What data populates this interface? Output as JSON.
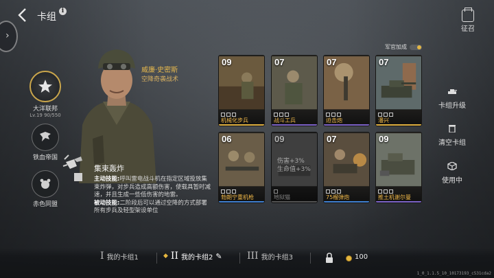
{
  "header": {
    "title": "卡组",
    "recruit_label": "征召"
  },
  "factions": [
    {
      "name": "大洋联邦",
      "level": "Lv.19  90/550",
      "icon": "star-icon",
      "active": true
    },
    {
      "name": "铁血帝国",
      "icon": "eagle-icon",
      "active": false
    },
    {
      "name": "赤色同盟",
      "icon": "bear-icon",
      "active": false
    }
  ],
  "commander": {
    "name": "威廉·史密斯",
    "subtitle": "空降奇袭战术",
    "skill_title": "集束轰炸",
    "active_label": "主动技能:",
    "active_text": "呼叫雷电战斗机在指定区域投放集束炸弹，对步兵造成高额伤害，使载具暂时减速，并且生成一些低伤害的地雷。",
    "passive_label": "被动技能:",
    "passive_text": "二阶段后可以通过空降的方式部署所有步兵及轻型架设单位"
  },
  "deck": {
    "bonus_label": "军官加成",
    "cards": [
      {
        "cost": "09",
        "name": "机械化步兵",
        "color": "#e0b040"
      },
      {
        "cost": "07",
        "name": "战斗工兵",
        "color": "#7b62c8"
      },
      {
        "cost": "07",
        "name": "迫击炮",
        "color": "#7b62c8"
      },
      {
        "cost": "07",
        "name": "潘兴",
        "color": "#e0b040"
      },
      {
        "cost": "06",
        "name": "勃朗宁重机枪",
        "color": "#3f7fd0"
      },
      {
        "cost": "09",
        "name": "地狱猫",
        "color": "#3f7fd0",
        "disabled": true,
        "stats": [
          "伤害+3%",
          "生命值+3%"
        ]
      },
      {
        "cost": "07",
        "name": "75榴弹炮",
        "color": "#3f7fd0"
      },
      {
        "cost": "09",
        "name": "推土机谢尔曼",
        "color": "#7b62c8"
      }
    ]
  },
  "actions": {
    "upgrade": "卡组升级",
    "clear": "清空卡组",
    "in_use": "使用中"
  },
  "bottom": {
    "tabs": [
      {
        "num": "I",
        "label": "我的卡组1"
      },
      {
        "num": "II",
        "label": "我的卡组2"
      },
      {
        "num": "III",
        "label": "我的卡组3"
      }
    ],
    "price": "100"
  },
  "version": "1_0_1.1.5_10_10173193_c531cda2"
}
